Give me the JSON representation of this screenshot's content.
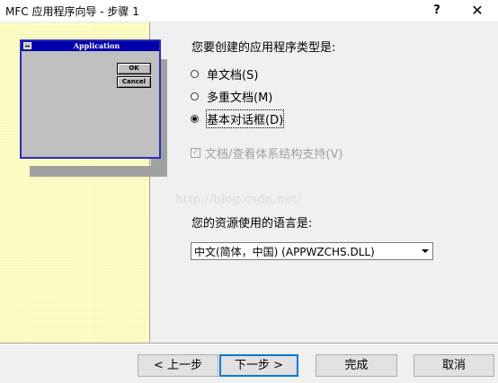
{
  "window": {
    "title": "MFC 应用程序向导 - 步骤 1",
    "help_glyph": "?",
    "close_glyph": "✕"
  },
  "preview": {
    "caption": "Application",
    "ok_label": "OK",
    "cancel_label": "Cancel"
  },
  "app_type": {
    "question": "您要创建的应用程序类型是:",
    "options": [
      {
        "label": "单文档(S)",
        "selected": false
      },
      {
        "label": "多重文档(M)",
        "selected": false
      },
      {
        "label": "基本对话框(D)",
        "selected": true
      }
    ],
    "doc_view_label": "文档/查看体系结构支持(V)",
    "doc_view_mark": "✓"
  },
  "watermark": "http://blog.csdn.net/",
  "language": {
    "question": "您的资源使用的语言是:",
    "selected": "中文(简体，中国) (APPWZCHS.DLL)"
  },
  "buttons": {
    "back": "< 上一步",
    "next": "下一步 >",
    "finish": "完成",
    "cancel": "取消"
  }
}
